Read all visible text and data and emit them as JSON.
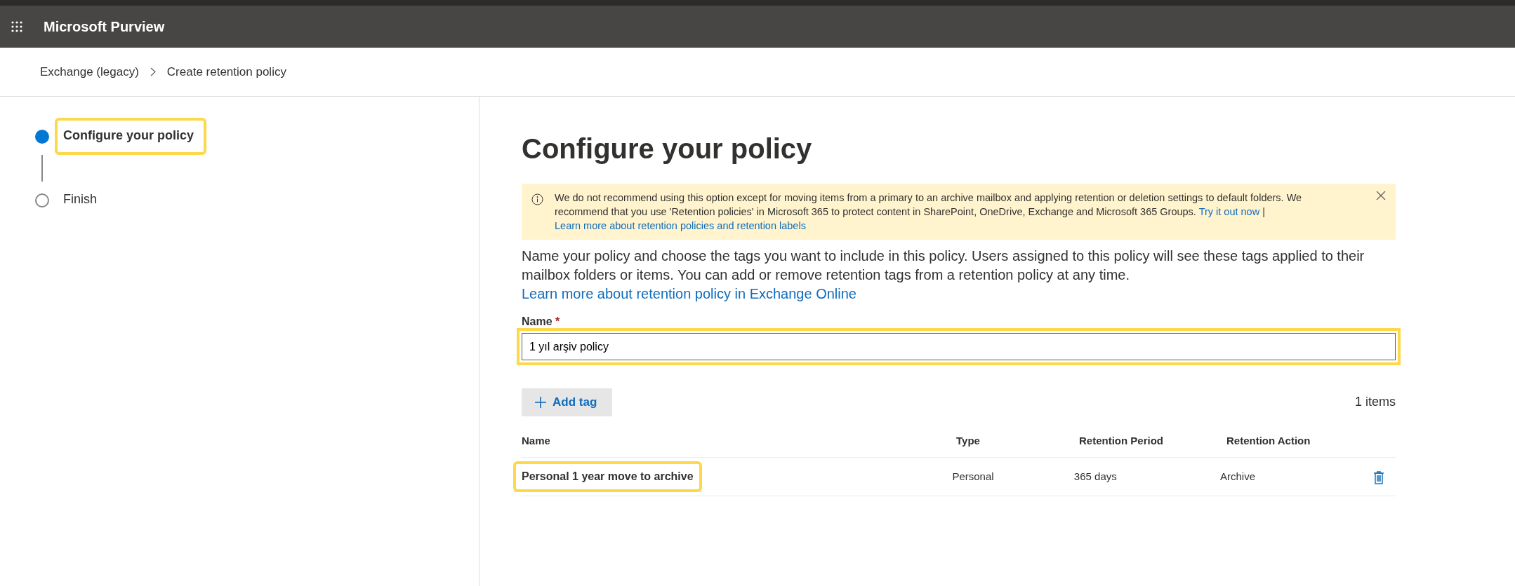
{
  "header": {
    "app_title": "Microsoft Purview"
  },
  "breadcrumb": [
    "Exchange (legacy)",
    "Create retention policy"
  ],
  "steps": [
    {
      "label": "Configure your policy",
      "selected": true,
      "highlighted": true
    },
    {
      "label": "Finish",
      "selected": false,
      "highlighted": false
    }
  ],
  "title": "Configure your policy",
  "banner": {
    "text": "We do not recommend using this option except for moving items from a primary to an archive mailbox and applying retention or deletion settings to default folders. We recommend that you use 'Retention policies' in Microsoft 365 to protect content in SharePoint, OneDrive, Exchange and Microsoft 365 Groups.",
    "link_1": "Try it out now",
    "separator": "|",
    "link_2": "Learn more about retention policies and retention labels"
  },
  "description": {
    "text": "Name your policy and choose the tags you want to include in this policy. Users assigned to this policy will see these tags applied to their mailbox folders or items. You can add or remove retention tags from a retention policy at any time.",
    "link": "Learn more about retention policy in Exchange Online"
  },
  "name_field": {
    "label": "Name",
    "required_mark": "*",
    "value": "1 yıl arşiv policy",
    "highlighted": true
  },
  "add_tag_button": "Add tag",
  "item_count": "1 items",
  "table": {
    "columns": [
      "Name",
      "Type",
      "Retention Period",
      "Retention Action"
    ],
    "rows": [
      {
        "cells": [
          "Personal 1 year move to archive",
          "Personal",
          "365 days",
          "Archive"
        ],
        "highlighted": true
      }
    ]
  }
}
